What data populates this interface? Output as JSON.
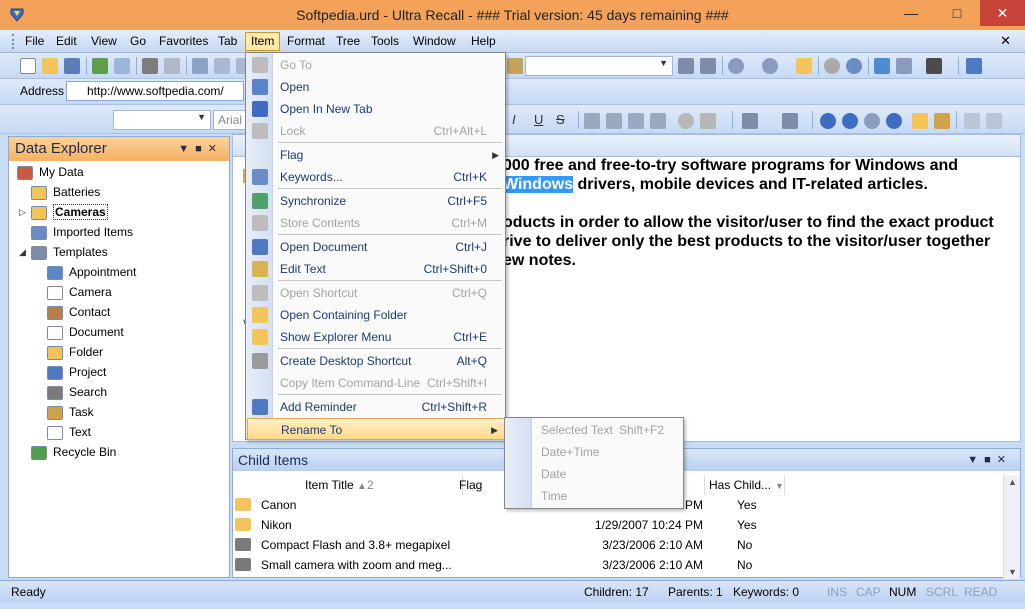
{
  "window": {
    "title": "Softpedia.urd - Ultra Recall - ### Trial version: 45 days remaining ###"
  },
  "colors": {
    "title_bar": "#f4a259",
    "close_button": "#c7433a",
    "panel_header": "#f6b162",
    "menu_hover": "#ffd98a",
    "selection_highlight": "#3399ff"
  },
  "menubar": {
    "items": [
      "File",
      "Edit",
      "View",
      "Go",
      "Favorites",
      "Tab",
      "Item",
      "Format",
      "Tree",
      "Tools",
      "Window",
      "Help"
    ],
    "active": "Item"
  },
  "address": {
    "label": "Address",
    "value": "http://www.softpedia.com/"
  },
  "format_toolbar": {
    "font": "Arial"
  },
  "data_explorer": {
    "title": "Data Explorer",
    "items": [
      {
        "label": "My Data",
        "icon": "home-icon"
      },
      {
        "label": "Batteries",
        "icon": "folder-icon"
      },
      {
        "label": "Cameras",
        "icon": "folder-icon",
        "selected": true
      },
      {
        "label": "Imported Items",
        "icon": "import-icon"
      },
      {
        "label": "Templates",
        "icon": "templates-icon"
      },
      {
        "label": "Appointment",
        "icon": "calendar-icon"
      },
      {
        "label": "Camera",
        "icon": "document-icon"
      },
      {
        "label": "Contact",
        "icon": "contact-icon"
      },
      {
        "label": "Document",
        "icon": "document-icon"
      },
      {
        "label": "Folder",
        "icon": "folder-icon"
      },
      {
        "label": "Project",
        "icon": "project-icon"
      },
      {
        "label": "Search",
        "icon": "search-icon"
      },
      {
        "label": "Task",
        "icon": "task-icon"
      },
      {
        "label": "Text",
        "icon": "text-icon"
      },
      {
        "label": "Recycle Bin",
        "icon": "recycle-bin-icon"
      }
    ]
  },
  "document": {
    "lines": [
      {
        "pre": "000 free and free-to-try software programs for Windows and",
        "hl": "",
        "post": ""
      },
      {
        "pre": "",
        "hl": "Windows",
        "post": " drivers, mobile devices and IT-related articles."
      },
      {
        "pre": "oducts in order to allow the visitor/user to find the exact product",
        "hl": "",
        "post": ""
      },
      {
        "pre": "rive to deliver only the best products to the visitor/user together",
        "hl": "",
        "post": ""
      },
      {
        "pre": "ew notes.",
        "hl": "",
        "post": ""
      }
    ]
  },
  "child_items": {
    "title": "Child Items",
    "columns": [
      "Item Title",
      "Flag",
      "Has Child..."
    ],
    "sort_indicator": "2",
    "rows": [
      {
        "title": "Canon",
        "date": "PM",
        "has_child": "Yes",
        "icon": "folder-icon"
      },
      {
        "title": "Nikon",
        "date": "1/29/2007 10:24 PM",
        "has_child": "Yes",
        "icon": "folder-icon"
      },
      {
        "title": "Compact Flash and 3.8+ megapixel",
        "date": "3/23/2006 2:10 AM",
        "has_child": "No",
        "icon": "search-icon"
      },
      {
        "title": "Small camera with zoom and meg...",
        "date": "3/23/2006 2:10 AM",
        "has_child": "No",
        "icon": "search-icon"
      }
    ]
  },
  "item_menu": {
    "items": [
      {
        "label": "Go To",
        "shortcut": "",
        "disabled": true,
        "icon": "go-to-icon"
      },
      {
        "label": "Open",
        "shortcut": "",
        "disabled": false,
        "icon": "open-icon"
      },
      {
        "label": "Open In New Tab",
        "shortcut": "",
        "disabled": false,
        "icon": "new-tab-icon"
      },
      {
        "label": "Lock",
        "shortcut": "Ctrl+Alt+L",
        "disabled": true,
        "icon": "lock-icon"
      },
      {
        "label": "Flag",
        "shortcut": "",
        "disabled": false,
        "submenu": true,
        "icon": ""
      },
      {
        "label": "Keywords...",
        "shortcut": "Ctrl+K",
        "disabled": false,
        "icon": "keywords-icon"
      },
      {
        "label": "Synchronize",
        "shortcut": "Ctrl+F5",
        "disabled": false,
        "icon": "synchronize-icon"
      },
      {
        "label": "Store Contents",
        "shortcut": "Ctrl+M",
        "disabled": true,
        "icon": "store-icon"
      },
      {
        "label": "Open Document",
        "shortcut": "Ctrl+J",
        "disabled": false,
        "icon": "open-document-icon"
      },
      {
        "label": "Edit Text",
        "shortcut": "Ctrl+Shift+0",
        "disabled": false,
        "icon": "edit-text-icon"
      },
      {
        "label": "Open Shortcut",
        "shortcut": "Ctrl+Q",
        "disabled": true,
        "icon": "shortcut-icon"
      },
      {
        "label": "Open Containing Folder",
        "shortcut": "",
        "disabled": false,
        "icon": "folder-icon"
      },
      {
        "label": "Show Explorer Menu",
        "shortcut": "Ctrl+E",
        "disabled": false,
        "icon": "explorer-menu-icon"
      },
      {
        "label": "Create Desktop Shortcut",
        "shortcut": "Alt+Q",
        "disabled": false,
        "icon": "desktop-shortcut-icon"
      },
      {
        "label": "Copy Item Command-Line",
        "shortcut": "Ctrl+Shift+I",
        "disabled": true,
        "icon": ""
      },
      {
        "label": "Add Reminder",
        "shortcut": "Ctrl+Shift+R",
        "disabled": false,
        "icon": "reminder-icon"
      },
      {
        "label": "Rename To",
        "shortcut": "",
        "disabled": false,
        "submenu": true,
        "hover": true,
        "icon": ""
      }
    ]
  },
  "rename_submenu": {
    "items": [
      {
        "label": "Selected Text",
        "shortcut": "Shift+F2"
      },
      {
        "label": "Date+Time",
        "shortcut": ""
      },
      {
        "label": "Date",
        "shortcut": ""
      },
      {
        "label": "Time",
        "shortcut": ""
      }
    ]
  },
  "statusbar": {
    "status": "Ready",
    "children": "Children: 17",
    "parents": "Parents: 1",
    "keywords": "Keywords: 0",
    "ins": "INS",
    "cap": "CAP",
    "num": "NUM",
    "scrl": "SCRL",
    "read": "READ"
  }
}
